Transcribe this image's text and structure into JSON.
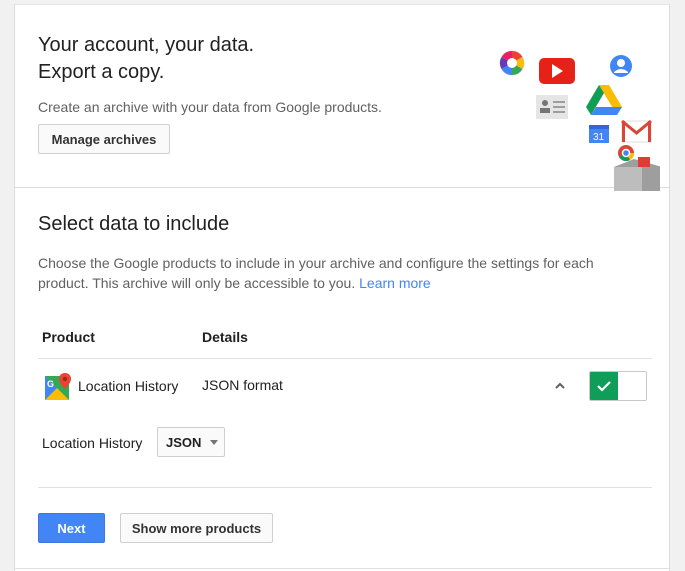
{
  "header": {
    "headline_line1": "Your account, your data.",
    "headline_line2": "Export a copy.",
    "description": "Create an archive with your data from Google products.",
    "manage_archives_label": "Manage archives"
  },
  "select_section": {
    "title": "Select data to include",
    "description": "Choose the Google products to include in your archive and configure the settings for each product. This archive will only be accessible to you.",
    "learn_more": "Learn more"
  },
  "table": {
    "headers": {
      "product": "Product",
      "details": "Details"
    },
    "rows": [
      {
        "product": "Location History",
        "details": "JSON format",
        "enabled": true,
        "icon": "google-maps-icon"
      }
    ]
  },
  "format_option": {
    "label": "Location History",
    "selected": "JSON"
  },
  "actions": {
    "next_label": "Next",
    "show_more_label": "Show more products"
  },
  "colors": {
    "primary_blue": "#4285f4",
    "toggle_green": "#0f9d58",
    "link_blue": "#4285f4"
  }
}
